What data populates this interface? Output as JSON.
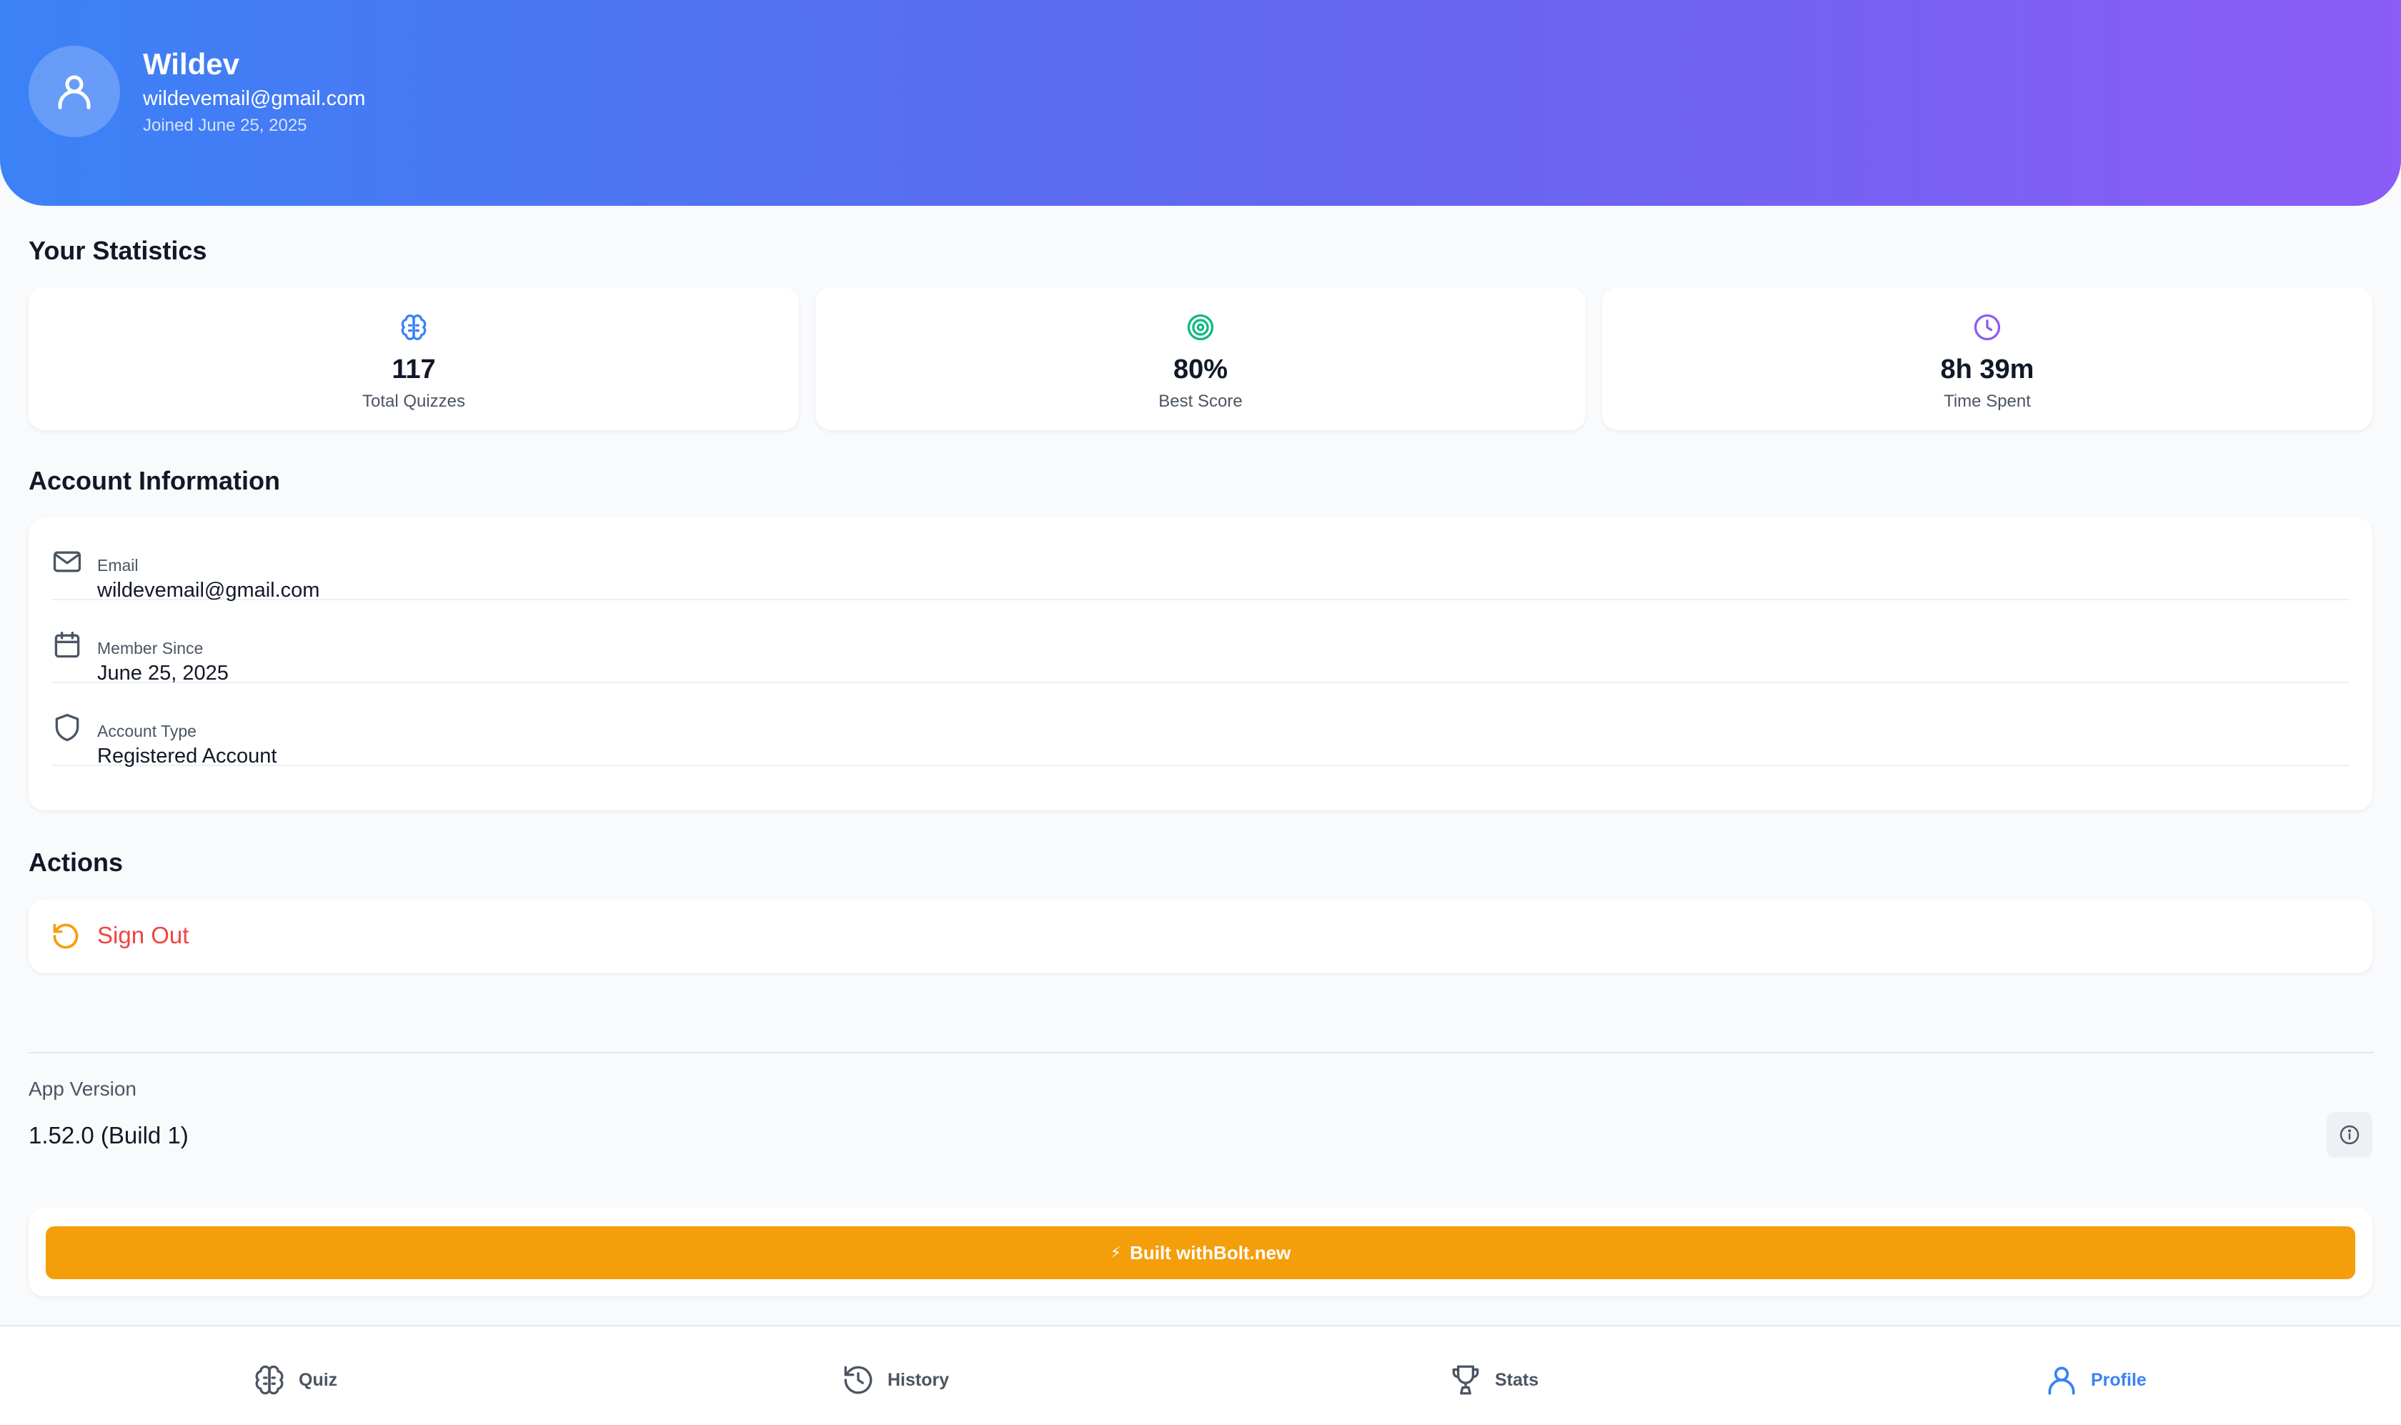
{
  "header": {
    "name": "Wildev",
    "email": "wildevemail@gmail.com",
    "joined": "Joined June 25, 2025"
  },
  "statistics": {
    "title": "Your Statistics",
    "cards": [
      {
        "value": "117",
        "label": "Total Quizzes",
        "icon": "brain-icon",
        "color": "#3b82f6"
      },
      {
        "value": "80%",
        "label": "Best Score",
        "icon": "target-icon",
        "color": "#10b981"
      },
      {
        "value": "8h 39m",
        "label": "Time Spent",
        "icon": "clock-icon",
        "color": "#8b5cf6"
      }
    ]
  },
  "account": {
    "title": "Account Information",
    "rows": [
      {
        "label": "Email",
        "value": "wildevemail@gmail.com",
        "icon": "mail-icon"
      },
      {
        "label": "Member Since",
        "value": "June 25, 2025",
        "icon": "calendar-icon"
      },
      {
        "label": "Account Type",
        "value": "Registered Account",
        "icon": "shield-icon"
      }
    ]
  },
  "actions": {
    "title": "Actions",
    "sign_out_label": "Sign Out",
    "sign_out_color": "#ef4444",
    "sign_out_icon_color": "#f59e0b"
  },
  "app_version": {
    "label": "App Version",
    "value": "1.52.0 (Build 1)"
  },
  "bolt": {
    "glyph": "⚡",
    "label": "Built withBolt.new",
    "color": "#f59e0b"
  },
  "nav": {
    "items": [
      {
        "label": "Quiz",
        "icon": "brain-icon"
      },
      {
        "label": "History",
        "icon": "history-icon"
      },
      {
        "label": "Stats",
        "icon": "trophy-icon"
      },
      {
        "label": "Profile",
        "icon": "user-icon",
        "active": true
      }
    ],
    "active_color": "#3b82f6"
  }
}
